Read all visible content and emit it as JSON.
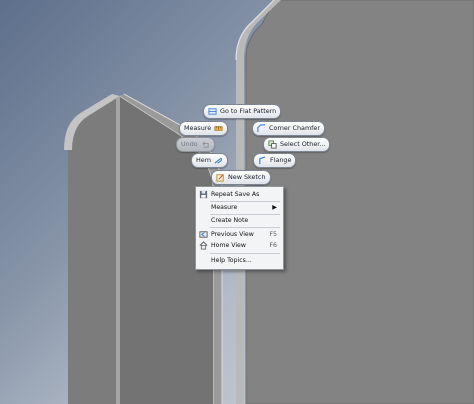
{
  "marking_menu": {
    "go_to_flat_pattern": "Go to Flat Pattern",
    "measure": "Measure",
    "corner_chamfer": "Corner Chamfer",
    "undo": "Undo",
    "select_other": "Select Other...",
    "hem": "Hem",
    "flange": "Flange",
    "new_sketch": "New Sketch"
  },
  "context_menu": {
    "items": [
      {
        "label": "Repeat Save As",
        "shortcut": ""
      },
      {
        "label": "Measure",
        "shortcut": ""
      },
      {
        "label": "Create Note",
        "shortcut": ""
      },
      {
        "label": "Previous View",
        "shortcut": "F5"
      },
      {
        "label": "Home View",
        "shortcut": "F6"
      },
      {
        "label": "Help Topics...",
        "shortcut": ""
      }
    ]
  },
  "colors": {
    "model_face": "#838383",
    "model_edge": "#d8d8d8",
    "accent_blue": "#3b7fd4"
  }
}
